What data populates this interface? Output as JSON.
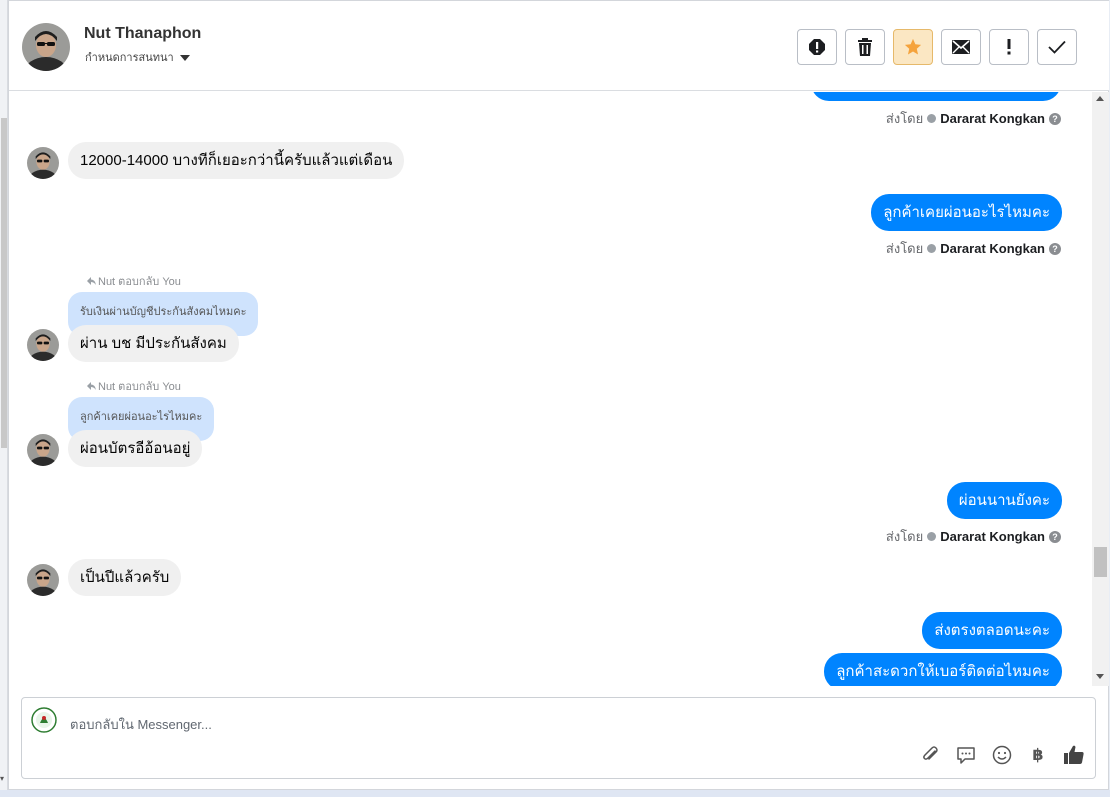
{
  "header": {
    "name": "Nut Thanaphon",
    "subtitle": "กำหนดการสนทนา",
    "actions": [
      "report-icon",
      "trash-icon",
      "star-icon",
      "mail-icon",
      "important-icon",
      "check-icon"
    ]
  },
  "messages": [
    {
      "type": "in",
      "text": "12000-14000 บางทีก็เยอะกว่านี้ครับแล้วแต่เดือน"
    },
    {
      "type": "out",
      "text": "ลูกค้าเคยผ่อนอะไรไหมคะ",
      "sent_by_label": "ส่งโดย",
      "sent_by": "Dararat Kongkan"
    },
    {
      "type": "in",
      "reply_label": "Nut ตอบกลับ You",
      "quote": "รับเงินผ่านบัญชีประกันสังคมไหมคะ",
      "text": "ผ่าน บช มีประกันสังคม"
    },
    {
      "type": "in",
      "reply_label": "Nut ตอบกลับ You",
      "quote": "ลูกค้าเคยผ่อนอะไรไหมคะ",
      "text": "ผ่อนบัตรอีอ้อนอยู่"
    },
    {
      "type": "out",
      "text": "ผ่อนนานยังคะ",
      "sent_by_label": "ส่งโดย",
      "sent_by": "Dararat Kongkan"
    },
    {
      "type": "in",
      "text": "เป็นปีแล้วครับ"
    },
    {
      "type": "out",
      "text": "ส่งตรงตลอดนะคะ"
    },
    {
      "type": "out",
      "text": "ลูกค้าสะดวกให้เบอร์ติดต่อไหมคะ"
    }
  ],
  "top_sent": {
    "sent_by_label": "ส่งโดย",
    "sent_by": "Dararat Kongkan"
  },
  "composer": {
    "placeholder": "ตอบกลับใน Messenger...",
    "tools": [
      "attach-icon",
      "saved-reply-icon",
      "emoji-icon",
      "baht-icon",
      "like-icon"
    ],
    "baht": "฿"
  },
  "colors": {
    "outgoing": "#0084ff",
    "incoming": "#f0f0f0",
    "quote": "#cfe3fd"
  }
}
